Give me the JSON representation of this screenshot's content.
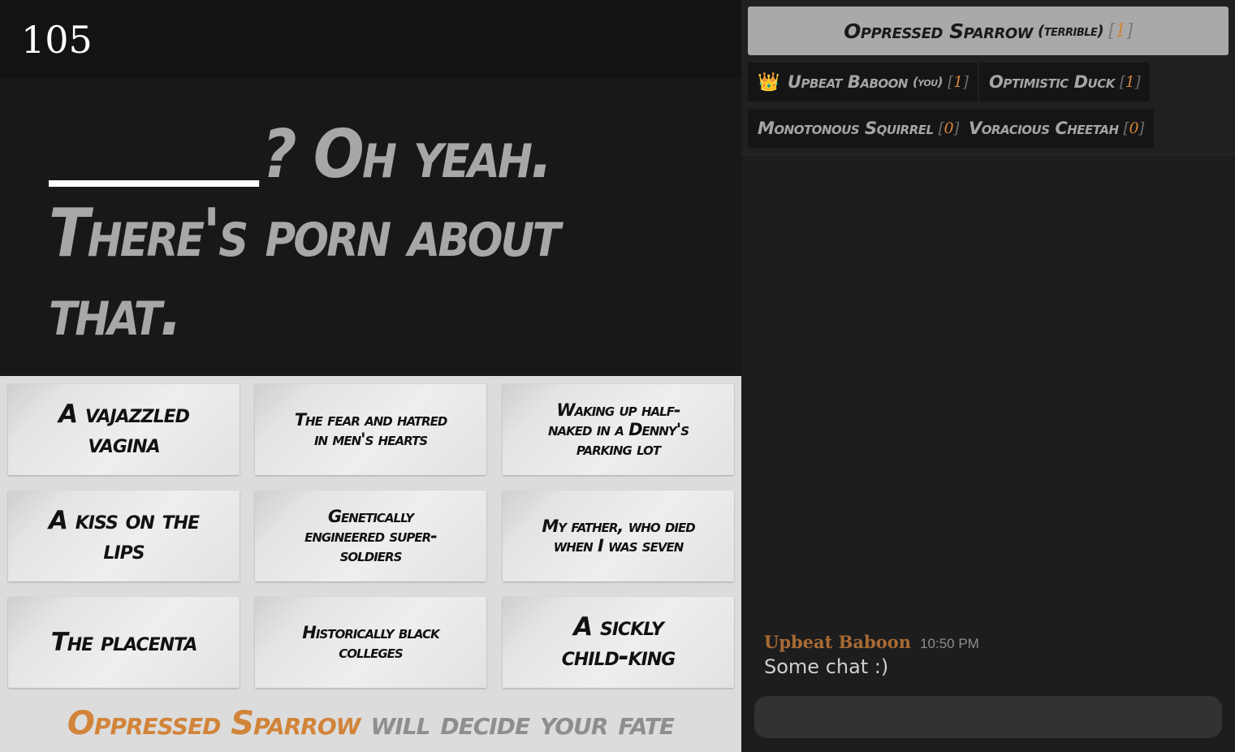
{
  "game": {
    "timer": "105",
    "prompt_text": "? Oh yeah. There's porn about that.",
    "cards": [
      "A vajazzled vagina",
      "The fear and hatred in men's hearts",
      "Waking up half-naked in a Denny's parking lot",
      "A kiss on the lips",
      "Genetically engineered super-soldiers",
      "My father, who died when I was seven",
      "The placenta",
      "Historically black colleges",
      "A sickly child-king"
    ],
    "fate": {
      "name": "Oppressed Sparrow",
      "rest": "will decide your fate"
    }
  },
  "players": {
    "czar": {
      "name": "Oppressed Sparrow",
      "tag": "(terrible)",
      "score": "1"
    },
    "list": [
      {
        "name": "Upbeat Baboon",
        "tag": "(you)",
        "score": "1",
        "crown": true
      },
      {
        "name": "Optimistic Duck",
        "tag": "",
        "score": "1"
      },
      {
        "name": "Monotonous Squirrel",
        "tag": "",
        "score": "0"
      },
      {
        "name": "Voracious Cheetah",
        "tag": "",
        "score": "0"
      }
    ]
  },
  "chat": {
    "messages": [
      {
        "author": "Upbeat Baboon",
        "time": "10:50 PM",
        "text": "Some chat :)"
      }
    ],
    "input_value": ""
  },
  "colors": {
    "accent": "#d2843a",
    "czar_bg": "#a9a9a9",
    "hand_bg": "#dcdcdc"
  }
}
